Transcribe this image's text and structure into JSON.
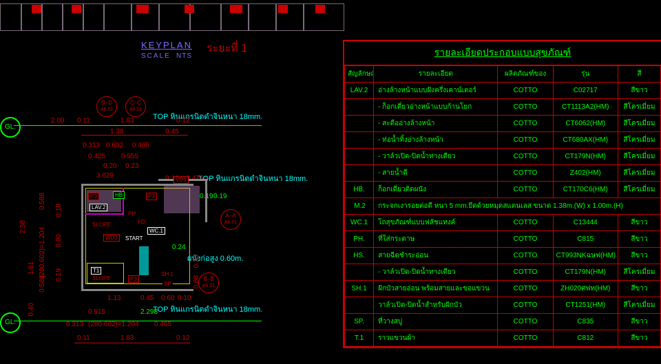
{
  "keyplan": {
    "label": "KEYPLAN",
    "scale_label": "SCALE",
    "scale_value": "NTS",
    "level_label": "ระยะที่ 1"
  },
  "gl": {
    "left": "GL.",
    "right": "GL."
  },
  "section_bubbles": {
    "d": {
      "top": "D–D",
      "bottom": "A6.01"
    },
    "c": {
      "top": "C–C",
      "bottom": "A6.01"
    },
    "a": {
      "top": "A–A",
      "bottom": "A6.01"
    },
    "b": {
      "top": "B–B",
      "bottom": "A6.01"
    }
  },
  "notes": {
    "top1": "TOP หินแกรนิตดำจินหนา 18mm.",
    "top2": "TOP หินแกรนิตดำจินหนา 18mm.",
    "top3": "TOP หินแกรนิตดำจินหนา 18mm.",
    "wall": "ผนังก่อสูง 0.60m."
  },
  "tags": {
    "p3a": "P3",
    "hb": "HB",
    "p3b": "P3",
    "lav2": "LAV.2",
    "ph": "PH",
    "fd": "FD",
    "wd3": "WD3",
    "start": "START",
    "wc1": "WC.1",
    "t1": "T1",
    "slope1": "SLOPE",
    "slope2": "SLOPE",
    "p3c": "P3",
    "sh1": "SH.1",
    "sp": "SP",
    "vd5": "VD5"
  },
  "dims": {
    "h_top": [
      "2.00",
      "0.11",
      "1.83",
      "0.12"
    ],
    "h_top2": [
      "1.38",
      "0.45"
    ],
    "h_top3": [
      "0.313",
      "0.602",
      "0.465"
    ],
    "h_top4": [
      "0.425",
      "0.955"
    ],
    "h_top5": [
      "0.20",
      "0.23"
    ],
    "h_mid": "3.629",
    "h_vd": [
      "0.16",
      "0.476"
    ],
    "h_note": [
      "0.19",
      "0.19"
    ],
    "h_wall": "0.24",
    "h_bot1": [
      "1.13",
      "0.45",
      "0.60",
      "0.10"
    ],
    "h_bot2": [
      "0.915",
      "2.298"
    ],
    "h_bot3": [
      "0.313",
      "(280.602)=1.204",
      "0.465"
    ],
    "h_bot4": [
      "0.11",
      "1.83",
      "0.12"
    ],
    "v_left_outer": "2.38",
    "v_left_inner": [
      "1.61",
      "0.40"
    ],
    "v_pair": [
      "0.588",
      "(280.602)=1.204",
      "0.588"
    ],
    "v_inner2": [
      "0.19",
      "0.80",
      "0.19"
    ],
    "v_right": [
      "0.20",
      "0.88"
    ]
  },
  "spec": {
    "title": "รายละเอียดประกอบแบบสุขภัณฑ์",
    "headers": {
      "sym": "สัญลักษณ์",
      "desc": "รายละเอียด",
      "mfr": "ผลิตภัณฑ์ของ",
      "mdl": "รุ่น",
      "clr": "สี"
    },
    "rows": [
      {
        "sym": "LAV.2",
        "desc": "อ่างล้างหน้าแบบฝังครึ่งเคาน์เตอร์",
        "mfr": "COTTO",
        "mdl": "C02717",
        "clr": "สีขาว"
      },
      {
        "sym": "",
        "desc": "- ก็อกเดี่ยวอ่างหน้าแบบก้านโยก",
        "mfr": "COTTO",
        "mdl": "CT1113A2(HM)",
        "clr": "สีโครเมี่ยม"
      },
      {
        "sym": "",
        "desc": "- สะดืออ่างล้างหน้า",
        "mfr": "COTTO",
        "mdl": "CT6062(HM)",
        "clr": "สีโครเมี่ยม"
      },
      {
        "sym": "",
        "desc": "- ท่อน้ำทิ้งอ่างล้างหน้า",
        "mfr": "COTTO",
        "mdl": "CT680AX(HM)",
        "clr": "สีโครเมี่ยม"
      },
      {
        "sym": "",
        "desc": "- วาล์วเปิด-ปิดน้ำทางเดียว",
        "mfr": "COTTO",
        "mdl": "CT179N(HM)",
        "clr": "สีโครเมี่ยม"
      },
      {
        "sym": "",
        "desc": "- สายน้ำดี",
        "mfr": "COTTO",
        "mdl": "Z402(HM)",
        "clr": "สีโครเมี่ยม"
      },
      {
        "sym": "HB.",
        "desc": "ก็อกเดี่ยวติดผนัง",
        "mfr": "COTTO",
        "mdl": "CT170C6(HM)",
        "clr": "สีโครเมี่ยม"
      },
      {
        "full": true,
        "sym": "M.2",
        "desc": "กระจกเงารอยต่อดี หนา 5 mm.ยึดด้วยหมุดสแตนเลส ขนาด 1.38m.(W) x 1.00m.(H)"
      },
      {
        "sym": "WC.1",
        "desc": "โถสุขภัณฑ์แบบฟลัชแทงค์",
        "mfr": "COTTO",
        "mdl": "C13444",
        "clr": "สีขาว"
      },
      {
        "sym": "PH.",
        "desc": "ที่ใส่กระดาษ",
        "mfr": "COTTO",
        "mdl": "C815",
        "clr": "สีขาว"
      },
      {
        "sym": "HS.",
        "desc": "สายฉีดชำระอ่อน",
        "mfr": "COTTO",
        "mdl": "CT993NKฉษฟ(HM)",
        "clr": "สีขาว"
      },
      {
        "sym": "",
        "desc": "- วาล์วเปิด-ปิดน้ำทางเดียว",
        "mfr": "COTTO",
        "mdl": "CT179N(HM)",
        "clr": "สีโครเมี่ยม"
      },
      {
        "sym": "SH.1",
        "desc": "ฝักบัวสายอ่อน พร้อมสายและขอแขวน",
        "mfr": "COTTO",
        "mdl": "ZH020ศฟท(HM)",
        "clr": "สีขาว"
      },
      {
        "sym": "",
        "desc": "วาล์วเปิด-ปิดน้ำสำหรับฝักบัว",
        "mfr": "COTTO",
        "mdl": "CT1251(HM)",
        "clr": "สีโครเมี่ยม"
      },
      {
        "sym": "SP.",
        "desc": "ที่วางสบู่",
        "mfr": "COTTO",
        "mdl": "C835",
        "clr": "สีขาว"
      },
      {
        "sym": "T.1",
        "desc": "ราวแขวนผ้า",
        "mfr": "COTTO",
        "mdl": "C812",
        "clr": "สีขาว"
      }
    ]
  }
}
